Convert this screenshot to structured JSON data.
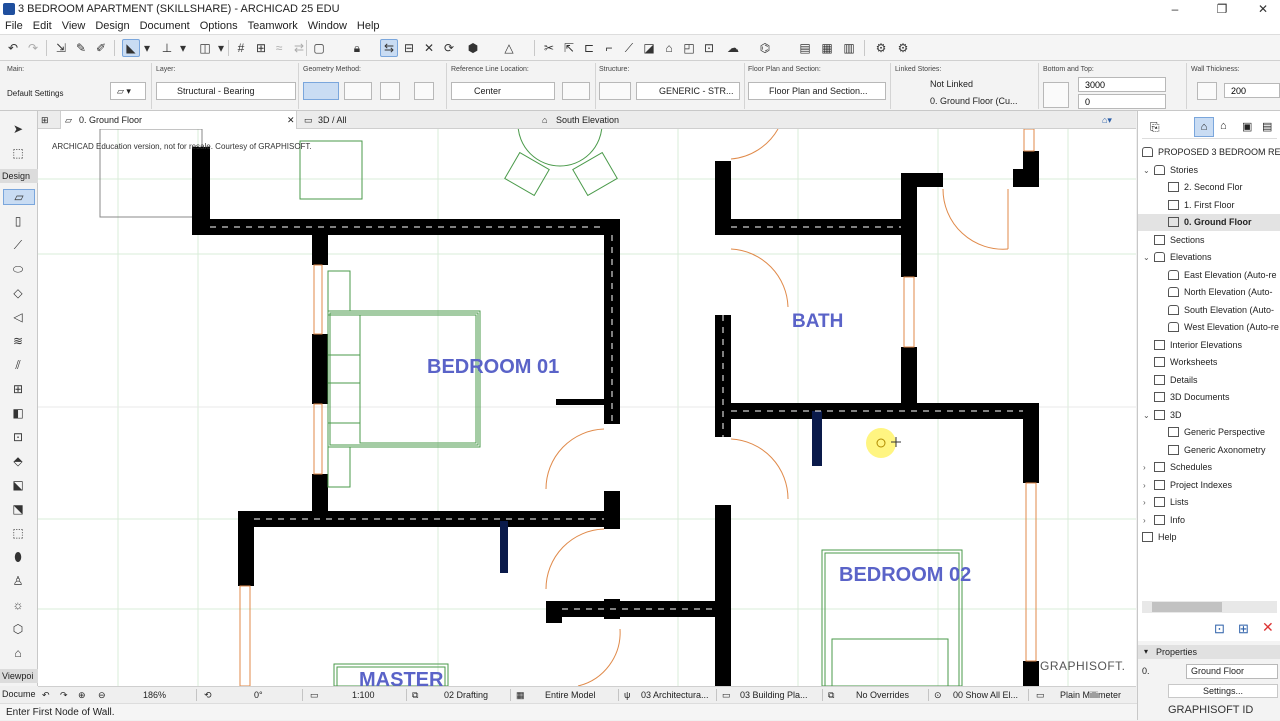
{
  "window": {
    "title": "3 BEDROOM APARTMENT (SKILLSHARE) - ARCHICAD 25 EDU",
    "minimize": "–",
    "restore": "❐",
    "close": "✕"
  },
  "menu": [
    "File",
    "Edit",
    "View",
    "Design",
    "Document",
    "Options",
    "Teamwork",
    "Window",
    "Help"
  ],
  "infobox": {
    "main_label": "Main:",
    "main_value": "Default Settings",
    "layer_label": "Layer:",
    "layer_value": "Structural - Bearing",
    "geometry_label": "Geometry Method:",
    "refline_label": "Reference Line Location:",
    "refline_value": "Center",
    "structure_label": "Structure:",
    "structure_value": "GENERIC - STR...",
    "floorplan_label": "Floor Plan and Section:",
    "floorplan_value": "Floor Plan and Section...",
    "linked_label": "Linked Stories:",
    "linked_top": "Not Linked",
    "linked_bottom": "0. Ground Floor (Cu...",
    "bottomtop_label": "Bottom and Top:",
    "top_value": "3000",
    "bottom_value": "0",
    "thickness_label": "Wall Thickness:",
    "thickness_value": "200"
  },
  "toolbox": {
    "design_label": "Design",
    "viewpoint_label": "Viewpoi",
    "document_label": "Docume"
  },
  "tabs": [
    "0. Ground Floor",
    "3D / All",
    "South Elevation"
  ],
  "canvas": {
    "watermark": "ARCHICAD Education version, not for resale. Courtesy of GRAPHISOFT.",
    "logo": "GRAPHISOFT.",
    "rooms": [
      "BEDROOM 01",
      "BATH",
      "BEDROOM 02",
      "MASTER"
    ]
  },
  "navigator": {
    "items": [
      {
        "label": "PROPOSED 3 BEDROOM RE"
      },
      {
        "label": "Stories"
      },
      {
        "label": "2. Second Flor"
      },
      {
        "label": "1. First Floor"
      },
      {
        "label": "0. Ground Floor"
      },
      {
        "label": "Sections"
      },
      {
        "label": "Elevations"
      },
      {
        "label": "East Elevation (Auto-re"
      },
      {
        "label": "North Elevation (Auto-"
      },
      {
        "label": "South Elevation (Auto-"
      },
      {
        "label": "West Elevation (Auto-re"
      },
      {
        "label": "Interior Elevations"
      },
      {
        "label": "Worksheets"
      },
      {
        "label": "Details"
      },
      {
        "label": "3D Documents"
      },
      {
        "label": "3D"
      },
      {
        "label": "Generic Perspective"
      },
      {
        "label": "Generic Axonometry"
      },
      {
        "label": "Schedules"
      },
      {
        "label": "Project Indexes"
      },
      {
        "label": "Lists"
      },
      {
        "label": "Info"
      },
      {
        "label": "Help"
      }
    ]
  },
  "properties": {
    "title": "Properties",
    "story_num": "0.",
    "story_name": "Ground Floor",
    "settings": "Settings...",
    "brand": "GRAPHISOFT ID"
  },
  "statusbar": {
    "zoom": "186%",
    "angle": "0°",
    "scale": "1:100",
    "layer_combo": "02 Drafting",
    "model_view": "Entire Model",
    "pen_set": "03 Architectura...",
    "mvo": "03 Building Pla...",
    "overrides": "No Overrides",
    "renovation": "00 Show All El...",
    "dimension": "Plain Millimeter"
  },
  "hint": "Enter First Node of Wall."
}
